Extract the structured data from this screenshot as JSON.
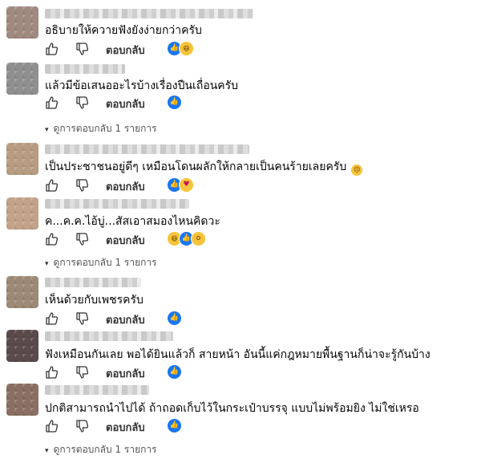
{
  "ui": {
    "reply_label": "ตอบกลับ",
    "view_replies_label": "ดูการตอบกลับ 1 รายการ",
    "colors": {
      "like_blue": "#1877f2",
      "emoji_yellow": "#f7c33a",
      "text": "#050505",
      "muted": "#555555"
    }
  },
  "comments": [
    {
      "text": "อธิบายให้ควายฟังยังง่ายกว่าครับ",
      "reactions": [
        "like",
        "haha"
      ],
      "avatar_color": "#a08a80",
      "view_replies": false
    },
    {
      "text": "แล้วมีข้อเสนออะไรบ้างเรื่องปืนเถื่อนครับ",
      "reactions": [
        "like"
      ],
      "avatar_color": "#8f8f8f",
      "view_replies": true
    },
    {
      "text": "เป็นประชาชนอยู่ดีๆ เหมือนโดนผลักให้กลายเป็นคนร้ายเลยครับ",
      "trailing_emoji": "sad-face-icon",
      "reactions": [
        "like",
        "care"
      ],
      "avatar_color": "#b79c82",
      "view_replies": false
    },
    {
      "text": "ค...ค.ค.ไอ้บู่...สัสเอาสมองไหนคิดวะ",
      "reactions": [
        "haha",
        "like",
        "wow"
      ],
      "avatar_color": "#c2a289",
      "view_replies": true
    },
    {
      "text": "เห็นด้วยกับเพชรครับ",
      "reactions": [
        "like"
      ],
      "avatar_color": "#9c8a76",
      "view_replies": false
    },
    {
      "text": "ฟังเหมือนกันเลย พอได้ยินแล้วก็ สายหน้า อันนี้แค่กฎหมายพื้นฐานก็น่าจะรู้กันบ้าง",
      "reactions": [
        "like"
      ],
      "avatar_color": "#5a4a4a",
      "view_replies": false
    },
    {
      "text": "ปกติสามารถนำไปได้ ถ้าถอดเก็บไว้ในกระเป๋าบรรจุ แบบไม่พร้อมยิง ไม่ใช่เหรอ",
      "reactions": [
        "like"
      ],
      "avatar_color": "#8a6f62",
      "view_replies": true
    }
  ]
}
